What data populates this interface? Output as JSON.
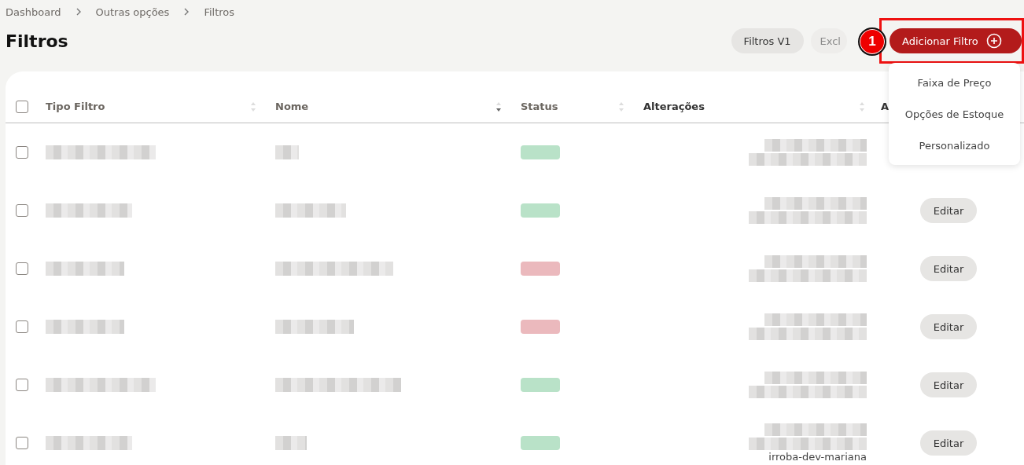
{
  "breadcrumb": [
    "Dashboard",
    "Outras opções",
    "Filtros"
  ],
  "title": "Filtros",
  "actions": [
    {
      "label": "Filtros V1",
      "kind": "secondary"
    },
    {
      "label": "Excl",
      "kind": "secondary",
      "disabled": true
    },
    {
      "label": "Adicionar Filtro",
      "kind": "primary"
    }
  ],
  "annotation": {
    "number": "1"
  },
  "menu": {
    "items": [
      "Faixa de Preço",
      "Opções de Estoque",
      "Personalizado"
    ]
  },
  "table": {
    "select_all_checked": false,
    "columns": [
      {
        "label": "Tipo Filtro",
        "sortable": true,
        "sorted": false
      },
      {
        "label": "Nome",
        "sortable": true,
        "sorted": true
      },
      {
        "label": "Status",
        "sortable": true,
        "sorted": false
      },
      {
        "label": "Alterações",
        "sortable": true,
        "sorted": false
      },
      {
        "label": "A"
      }
    ],
    "rows": [
      {
        "checked": false,
        "color": "#b9e2c8"
      },
      {
        "checked": false,
        "color": "#b9e2c8",
        "action": "Editar"
      },
      {
        "checked": false,
        "color": "#ebb9bd",
        "action": "Editar"
      },
      {
        "checked": false,
        "color": "#ebb9bd",
        "action": "Editar"
      },
      {
        "checked": false,
        "color": "#b9e2c8",
        "action": "Editar"
      },
      {
        "checked": false,
        "color": "#b9e2c8",
        "action": "Editar",
        "changed_by": "irroba-dev-mariana"
      }
    ]
  }
}
